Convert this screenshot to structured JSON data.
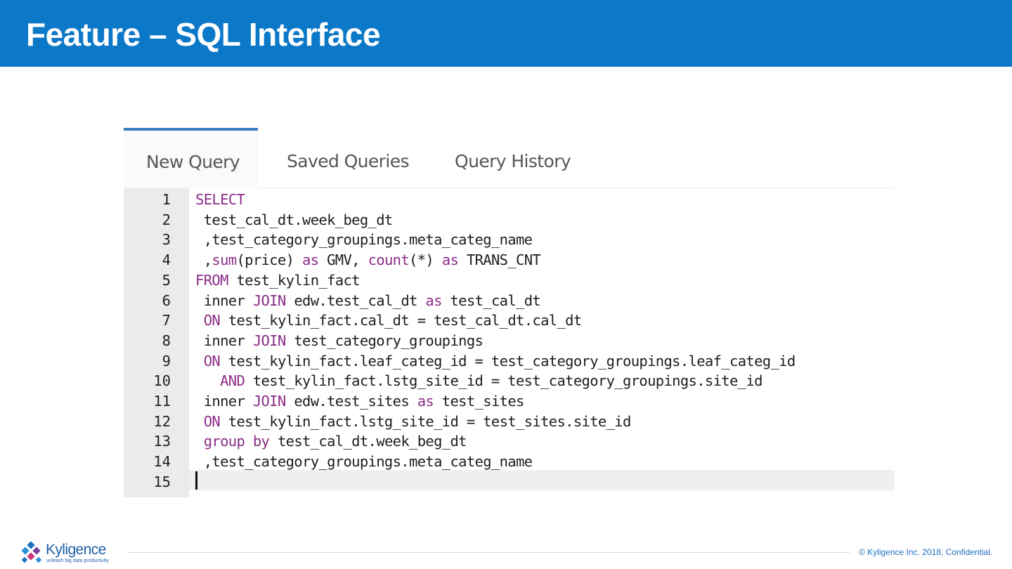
{
  "slide": {
    "title": "Feature – SQL Interface"
  },
  "tabs": [
    {
      "label": "New Query",
      "active": true
    },
    {
      "label": "Saved Queries",
      "active": false
    },
    {
      "label": "Query History",
      "active": false
    }
  ],
  "editor": {
    "line_numbers": [
      "1",
      "2",
      "3",
      "4",
      "5",
      "6",
      "7",
      "8",
      "9",
      "10",
      "11",
      "12",
      "13",
      "14",
      "15"
    ],
    "lines": [
      [
        {
          "t": "SELECT",
          "c": "kw"
        }
      ],
      [
        {
          "t": " test_cal_dt.week_beg_dt",
          "c": ""
        }
      ],
      [
        {
          "t": " ,test_category_groupings.meta_categ_name",
          "c": ""
        }
      ],
      [
        {
          "t": " ,",
          "c": ""
        },
        {
          "t": "sum",
          "c": "fn"
        },
        {
          "t": "(price) ",
          "c": ""
        },
        {
          "t": "as",
          "c": "kw"
        },
        {
          "t": " GMV, ",
          "c": ""
        },
        {
          "t": "count",
          "c": "fn"
        },
        {
          "t": "(*) ",
          "c": ""
        },
        {
          "t": "as",
          "c": "kw"
        },
        {
          "t": " TRANS_CNT",
          "c": ""
        }
      ],
      [
        {
          "t": "FROM",
          "c": "kw"
        },
        {
          "t": " test_kylin_fact",
          "c": ""
        }
      ],
      [
        {
          "t": " inner ",
          "c": ""
        },
        {
          "t": "JOIN",
          "c": "kw"
        },
        {
          "t": " edw.test_cal_dt ",
          "c": ""
        },
        {
          "t": "as",
          "c": "kw"
        },
        {
          "t": " test_cal_dt",
          "c": ""
        }
      ],
      [
        {
          "t": " ",
          "c": ""
        },
        {
          "t": "ON",
          "c": "kw"
        },
        {
          "t": " test_kylin_fact.cal_dt = test_cal_dt.cal_dt",
          "c": ""
        }
      ],
      [
        {
          "t": " inner ",
          "c": ""
        },
        {
          "t": "JOIN",
          "c": "kw"
        },
        {
          "t": " test_category_groupings",
          "c": ""
        }
      ],
      [
        {
          "t": " ",
          "c": ""
        },
        {
          "t": "ON",
          "c": "kw"
        },
        {
          "t": " test_kylin_fact.leaf_categ_id = test_category_groupings.leaf_categ_id",
          "c": ""
        }
      ],
      [
        {
          "t": "   ",
          "c": ""
        },
        {
          "t": "AND",
          "c": "kw"
        },
        {
          "t": " test_kylin_fact.lstg_site_id = test_category_groupings.site_id",
          "c": ""
        }
      ],
      [
        {
          "t": " inner ",
          "c": ""
        },
        {
          "t": "JOIN",
          "c": "kw"
        },
        {
          "t": " edw.test_sites ",
          "c": ""
        },
        {
          "t": "as",
          "c": "kw"
        },
        {
          "t": " test_sites",
          "c": ""
        }
      ],
      [
        {
          "t": " ",
          "c": ""
        },
        {
          "t": "ON",
          "c": "kw"
        },
        {
          "t": " test_kylin_fact.lstg_site_id = test_sites.site_id",
          "c": ""
        }
      ],
      [
        {
          "t": " ",
          "c": ""
        },
        {
          "t": "group by",
          "c": "kw"
        },
        {
          "t": " test_cal_dt.week_beg_dt",
          "c": ""
        }
      ],
      [
        {
          "t": " ,test_category_groupings.meta_categ_name",
          "c": ""
        }
      ],
      [
        {
          "t": "",
          "c": ""
        }
      ]
    ]
  },
  "footer": {
    "logo_word": "Kyligence",
    "logo_tagline": "unleash big data productivity",
    "copyright": "© Kyligence Inc. 2018, Confidential."
  },
  "colors": {
    "header_bg": "#0b78c8",
    "keyword": "#8b2d86",
    "active_tab_border": "#3b7fc4"
  }
}
